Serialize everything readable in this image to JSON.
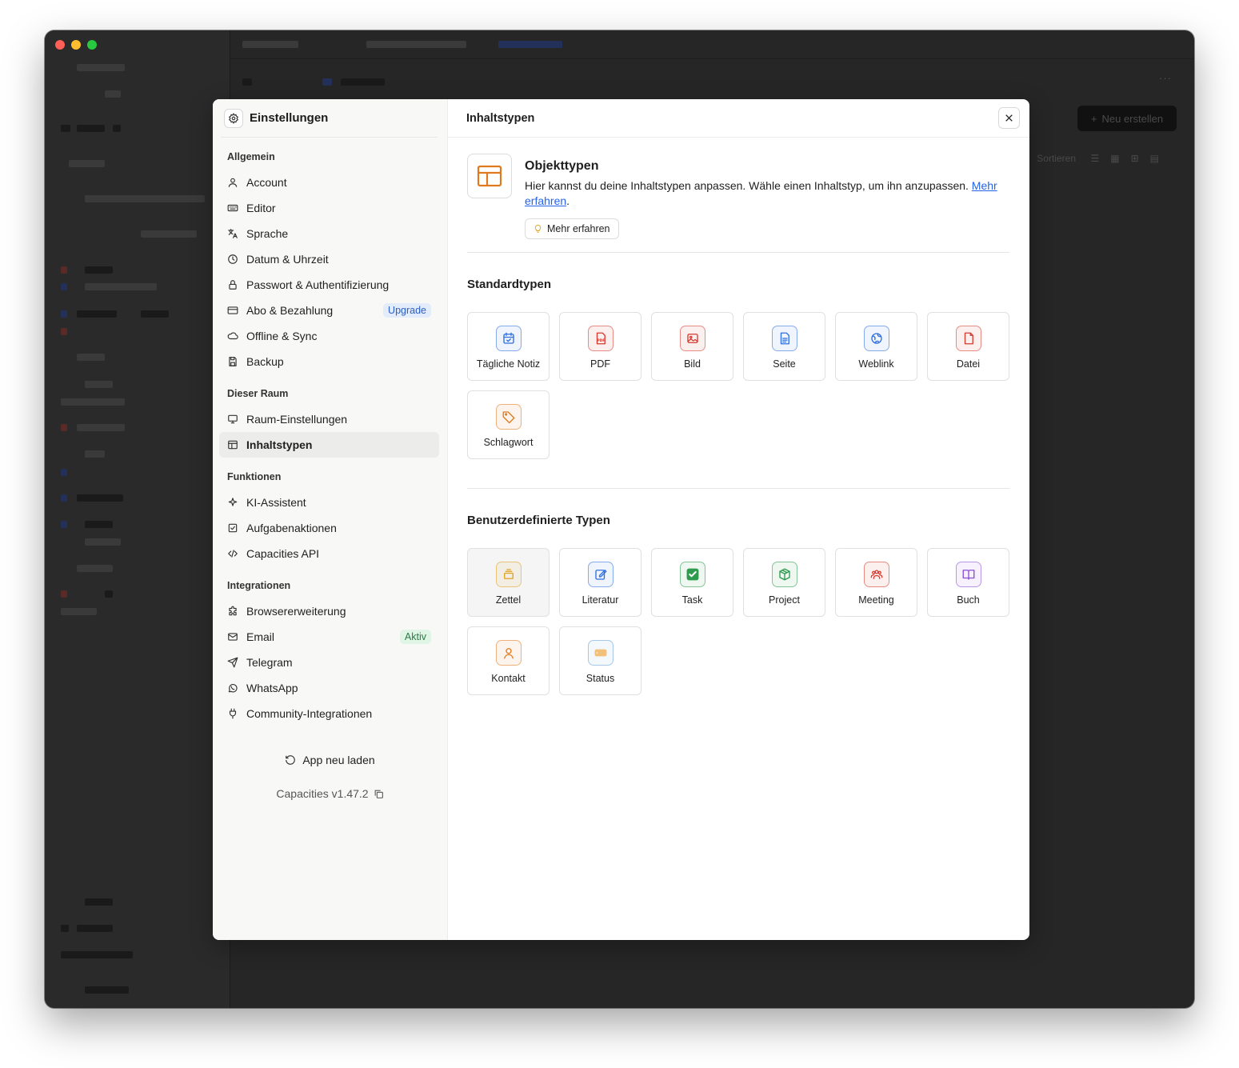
{
  "settings": {
    "title": "Einstellungen",
    "sections": [
      {
        "label": "Allgemein",
        "items": [
          {
            "label": "Account",
            "icon": "user-icon"
          },
          {
            "label": "Editor",
            "icon": "keyboard-icon"
          },
          {
            "label": "Sprache",
            "icon": "translate-icon"
          },
          {
            "label": "Datum & Uhrzeit",
            "icon": "clock-icon"
          },
          {
            "label": "Passwort & Authentifizierung",
            "icon": "lock-icon"
          },
          {
            "label": "Abo & Bezahlung",
            "icon": "credit-card-icon",
            "badge": "Upgrade"
          },
          {
            "label": "Offline & Sync",
            "icon": "cloud-icon"
          },
          {
            "label": "Backup",
            "icon": "save-icon"
          }
        ]
      },
      {
        "label": "Dieser Raum",
        "items": [
          {
            "label": "Raum-Einstellungen",
            "icon": "monitor-icon"
          },
          {
            "label": "Inhaltstypen",
            "icon": "layout-icon"
          }
        ]
      },
      {
        "label": "Funktionen",
        "items": [
          {
            "label": "KI-Assistent",
            "icon": "sparkle-icon"
          },
          {
            "label": "Aufgabenaktionen",
            "icon": "checkbox-icon"
          },
          {
            "label": "Capacities API",
            "icon": "code-icon"
          }
        ]
      },
      {
        "label": "Integrationen",
        "items": [
          {
            "label": "Browsererweiterung",
            "icon": "puzzle-icon"
          },
          {
            "label": "Email",
            "icon": "mail-icon",
            "badge": "Aktiv"
          },
          {
            "label": "Telegram",
            "icon": "send-icon"
          },
          {
            "label": "WhatsApp",
            "icon": "whatsapp-icon"
          },
          {
            "label": "Community-Integrationen",
            "icon": "plug-icon"
          }
        ]
      }
    ],
    "reload_label": "App neu laden",
    "version": "Capacities v1.47.2"
  },
  "content": {
    "title": "Inhaltstypen",
    "intro_title": "Objekttypen",
    "intro_desc": "Hier kannst du deine Inhaltstypen anpassen. Wähle einen Inhaltstyp, um ihn anzupassen. ",
    "intro_link": "Mehr erfahren",
    "intro_after": ".",
    "learn_button": "Mehr erfahren",
    "standard_title": "Standardtypen",
    "standard_types": [
      {
        "label": "Tägliche Notiz",
        "color": "#2f6fe0",
        "icon": "calendar-icon"
      },
      {
        "label": "PDF",
        "color": "#d63a2f",
        "icon": "pdf-icon"
      },
      {
        "label": "Bild",
        "color": "#d63a2f",
        "icon": "image-icon"
      },
      {
        "label": "Seite",
        "color": "#2f6fe0",
        "icon": "page-icon"
      },
      {
        "label": "Weblink",
        "color": "#2f6fe0",
        "icon": "globe-icon"
      },
      {
        "label": "Datei",
        "color": "#d63a2f",
        "icon": "file-icon"
      },
      {
        "label": "Schlagwort",
        "color": "#e07a1f",
        "icon": "tag-icon"
      }
    ],
    "custom_title": "Benutzerdefinierte Typen",
    "custom_types": [
      {
        "label": "Zettel",
        "color": "#e0a21f",
        "icon": "stack-icon"
      },
      {
        "label": "Literatur",
        "color": "#2f6fe0",
        "icon": "edit-icon"
      },
      {
        "label": "Task",
        "color": "#2e9b4f",
        "icon": "check-icon"
      },
      {
        "label": "Project",
        "color": "#2e9b4f",
        "icon": "cube-icon"
      },
      {
        "label": "Meeting",
        "color": "#d63a2f",
        "icon": "people-icon"
      },
      {
        "label": "Buch",
        "color": "#8a4fd6",
        "icon": "book-icon"
      },
      {
        "label": "Kontakt",
        "color": "#e07a1f",
        "icon": "person-icon"
      },
      {
        "label": "Status",
        "color": "#6aa0d8",
        "icon": "status-icon"
      }
    ]
  },
  "background": {
    "new_button": "Neu erstellen",
    "sort_label": "Sortieren"
  }
}
